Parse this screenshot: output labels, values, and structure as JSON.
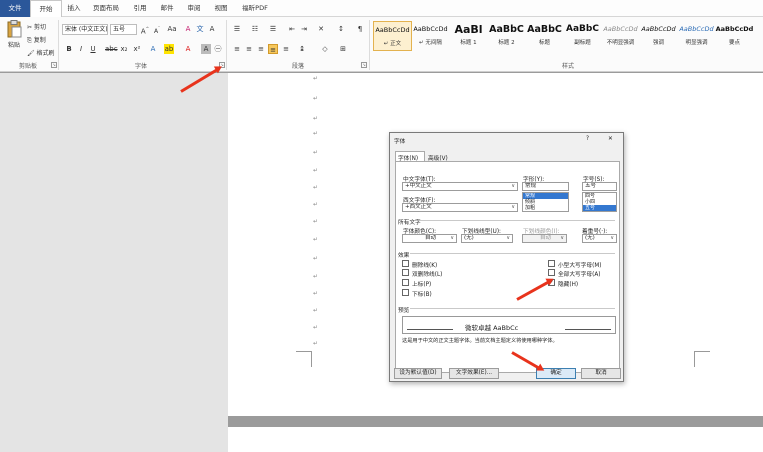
{
  "tabs": [
    "文件",
    "开始",
    "插入",
    "页面布局",
    "引用",
    "邮件",
    "审阅",
    "视图",
    "福昕PDF"
  ],
  "clipboard": {
    "paste": "粘贴",
    "cut": "剪切",
    "copy": "复制",
    "format_painter": "格式刷",
    "group": "剪贴板"
  },
  "font_group": {
    "font_name": "宋体 (中文正文)",
    "font_size": "五号",
    "group": "字体"
  },
  "paragraph_group": {
    "group": "段落"
  },
  "styles_group": {
    "group": "样式",
    "items": [
      {
        "preview": "AaBbCcDd",
        "name": "↵ 正文"
      },
      {
        "preview": "AaBbCcDd",
        "name": "↵ 无间隔"
      },
      {
        "preview": "AaBl",
        "name": "标题 1"
      },
      {
        "preview": "AaBbC",
        "name": "标题 2"
      },
      {
        "preview": "AaBbC",
        "name": "标题"
      },
      {
        "preview": "AaBbC",
        "name": "副标题"
      },
      {
        "preview": "AaBbCcDd",
        "name": "不明显强调"
      },
      {
        "preview": "AaBbCcDd",
        "name": "强调"
      },
      {
        "preview": "AaBbCcDd",
        "name": "明显强调"
      },
      {
        "preview": "AaBbCcDd",
        "name": "要点"
      }
    ]
  },
  "paragraph_mark": "↵",
  "dialog": {
    "title": "字体",
    "help": "?",
    "close": "✕",
    "tabs": [
      "字体(N)",
      "高级(V)"
    ],
    "chinese_font_label": "中文字体(T):",
    "chinese_font_value": "+中文正文",
    "western_font_label": "西文字体(F):",
    "western_font_value": "+西文正文",
    "style_label": "字形(Y):",
    "style_value": "常规",
    "style_options": [
      "常规",
      "倾斜",
      "加粗"
    ],
    "size_label": "字号(S):",
    "size_value": "五号",
    "size_options": [
      "四号",
      "小四",
      "五号"
    ],
    "all_text_label": "所有文字",
    "font_color_label": "字体颜色(C):",
    "font_color_value": "自动",
    "underline_label": "下划线线型(U):",
    "underline_value": "(无)",
    "underline_color_label": "下划线颜色(I):",
    "underline_color_value": "自动",
    "emphasis_label": "着重号(·):",
    "emphasis_value": "(无)",
    "effects_label": "效果",
    "effects_left": [
      "删除线(K)",
      "双删除线(L)",
      "上标(P)",
      "下标(B)"
    ],
    "effects_right": [
      "小型大写字母(M)",
      "全部大写字母(A)",
      "隐藏(H)"
    ],
    "effects_right_checked": [
      false,
      false,
      true
    ],
    "preview_label": "预览",
    "preview_text": "微软卓越 AaBbCc",
    "preview_note": "这是用于中文的正文主题字体。当前文档主题定义将使用哪种字体。",
    "set_default_button": "设为默认值(D)",
    "text_effects_button": "文字效果(E)...",
    "ok_button": "确定",
    "cancel_button": "取消"
  }
}
